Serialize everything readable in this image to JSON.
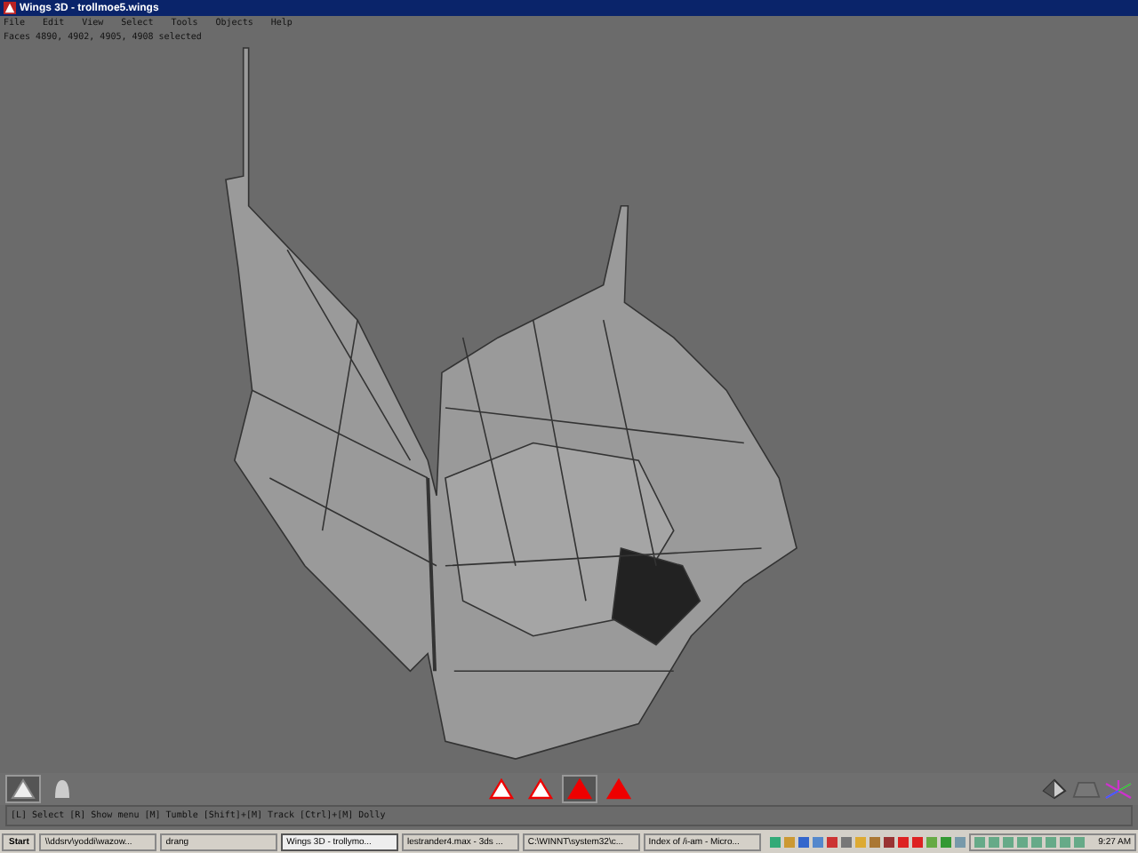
{
  "window": {
    "title": "Wings 3D - trollmoe5.wings"
  },
  "menu": [
    "File",
    "Edit",
    "View",
    "Select",
    "Tools",
    "Objects",
    "Help"
  ],
  "info_line": "Faces 4890, 4902, 4905, 4908 selected",
  "left_tools": [
    {
      "selected": true
    },
    {
      "selected": false
    }
  ],
  "selection_modes": [
    {
      "selected": false
    },
    {
      "selected": false
    },
    {
      "selected": true
    },
    {
      "selected": false
    }
  ],
  "status_line": "[L] Select  [R] Show menu  [M] Tumble  [Shift]+[M] Track  [Ctrl]+[M] Dolly",
  "taskbar": {
    "start": "Start",
    "tasks": [
      {
        "label": "\\\\ddsrv\\yoddi\\wazow...",
        "selected": false
      },
      {
        "label": "drang",
        "selected": false
      },
      {
        "label": "Wings 3D - trollymo...",
        "selected": true
      },
      {
        "label": "lestrander4.max - 3ds ...",
        "selected": false
      },
      {
        "label": "C:\\WINNT\\system32\\c...",
        "selected": false
      },
      {
        "label": "Index of /i-am - Micro...",
        "selected": false
      }
    ],
    "clock": "9:27 AM"
  }
}
